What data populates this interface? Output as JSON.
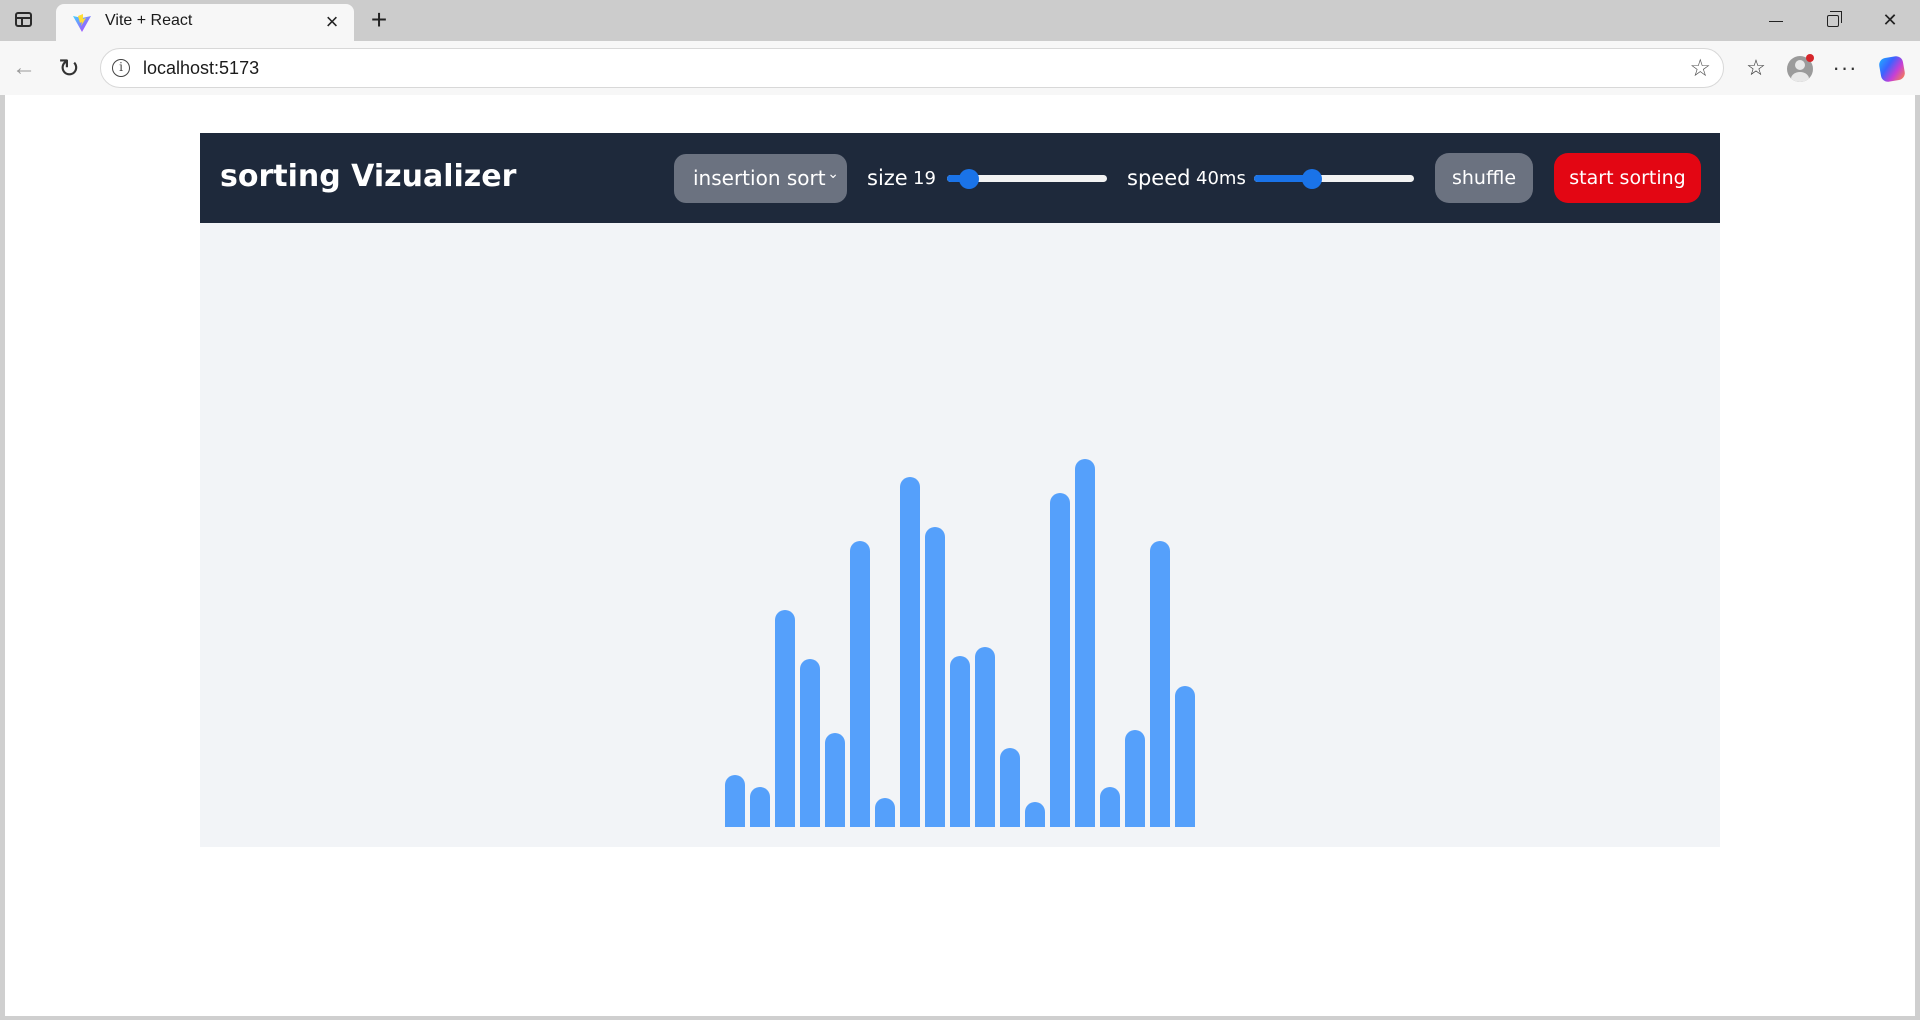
{
  "browser": {
    "tab_title": "Vite + React",
    "url": "localhost:5173"
  },
  "app": {
    "title": "sorting Vizualizer",
    "algorithm": {
      "selected": "insertion sort"
    },
    "size": {
      "label": "size",
      "value": "19",
      "slider_fraction": 0.14
    },
    "speed": {
      "label": "speed",
      "value": "40ms",
      "slider_fraction": 0.36
    },
    "shuffle_label": "shuffle",
    "start_label": "start sorting",
    "colors": {
      "header": "#1e293b",
      "bar": "#55a0fb",
      "start_button": "#e30613",
      "secondary_button": "#6b7280",
      "slider_accent": "#1a73e8"
    }
  },
  "array_values": [
    52,
    40,
    217,
    168,
    94,
    286,
    29,
    350,
    300,
    171,
    180,
    79,
    25,
    334,
    368,
    40,
    97,
    286,
    141
  ]
}
